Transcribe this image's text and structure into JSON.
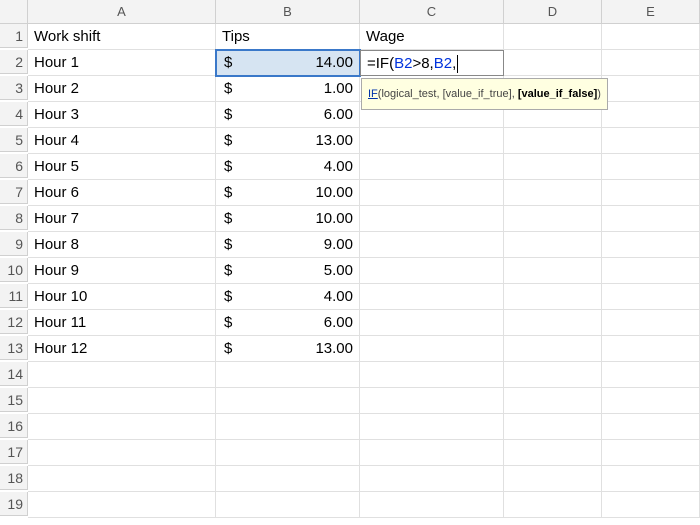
{
  "columns": [
    "A",
    "B",
    "C",
    "D",
    "E"
  ],
  "row_count": 19,
  "headers": {
    "A": "Work shift",
    "B": "Tips",
    "C": "Wage"
  },
  "rows": [
    {
      "label": "Hour 1",
      "tip": "14.00"
    },
    {
      "label": "Hour 2",
      "tip": "1.00"
    },
    {
      "label": "Hour 3",
      "tip": "6.00"
    },
    {
      "label": "Hour 4",
      "tip": "13.00"
    },
    {
      "label": "Hour 5",
      "tip": "4.00"
    },
    {
      "label": "Hour 6",
      "tip": "10.00"
    },
    {
      "label": "Hour 7",
      "tip": "10.00"
    },
    {
      "label": "Hour 8",
      "tip": "9.00"
    },
    {
      "label": "Hour 9",
      "tip": "5.00"
    },
    {
      "label": "Hour 10",
      "tip": "4.00"
    },
    {
      "label": "Hour 11",
      "tip": "6.00"
    },
    {
      "label": "Hour 12",
      "tip": "13.00"
    }
  ],
  "currency_symbol": "$",
  "active_cell": "C2",
  "referenced_cell": "B2",
  "formula": {
    "prefix": "=IF(",
    "ref1": "B2",
    "mid1": ">8,",
    "ref2": "B2",
    "suffix": ","
  },
  "tooltip": {
    "fn": "IF",
    "rest_open": "(logical_test, [value_if_true], ",
    "active_arg": "[value_if_false]",
    "rest_close": ")"
  }
}
